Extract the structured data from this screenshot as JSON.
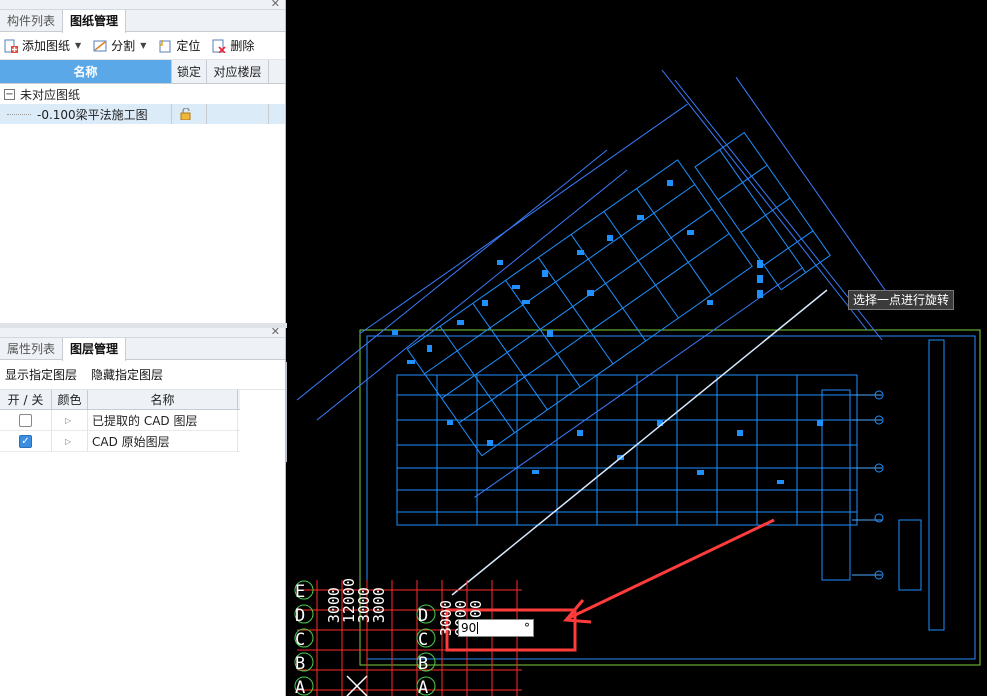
{
  "top_panel": {
    "tabs": [
      "构件列表",
      "图纸管理"
    ],
    "active_tab": 1,
    "toolbar": {
      "add_drawing": "添加图纸",
      "split": "分割",
      "locate": "定位",
      "delete": "删除"
    },
    "columns": {
      "name": "名称",
      "lock": "锁定",
      "floor": "对应楼层"
    },
    "tree": {
      "group": "未对应图纸",
      "item": "-0.100梁平法施工图"
    }
  },
  "bottom_panel": {
    "tabs": [
      "属性列表",
      "图层管理"
    ],
    "active_tab": 1,
    "actions": {
      "show": "显示指定图层",
      "hide": "隐藏指定图层"
    },
    "columns": {
      "on_off": "开 / 关",
      "color": "颜色",
      "name": "名称"
    },
    "layers": [
      {
        "name": "已提取的 CAD 图层",
        "on": false
      },
      {
        "name": "CAD 原始图层",
        "on": true
      }
    ]
  },
  "canvas": {
    "tooltip": "选择一点进行旋转",
    "angle_value": "90",
    "angle_unit": "°",
    "axis_labels_left": [
      "E",
      "D",
      "C",
      "B",
      "A"
    ],
    "axis_labels_mid": [
      "D",
      "C",
      "B",
      "A"
    ],
    "dim_labels": [
      "3000",
      "12000",
      "3000",
      "3000",
      "3000",
      "9000",
      "3000"
    ],
    "colors": {
      "cad": "#1e90ff",
      "grid": "#ff2a2a",
      "frame": "#7ccf3a",
      "arrow": "#ff3b3b"
    }
  }
}
